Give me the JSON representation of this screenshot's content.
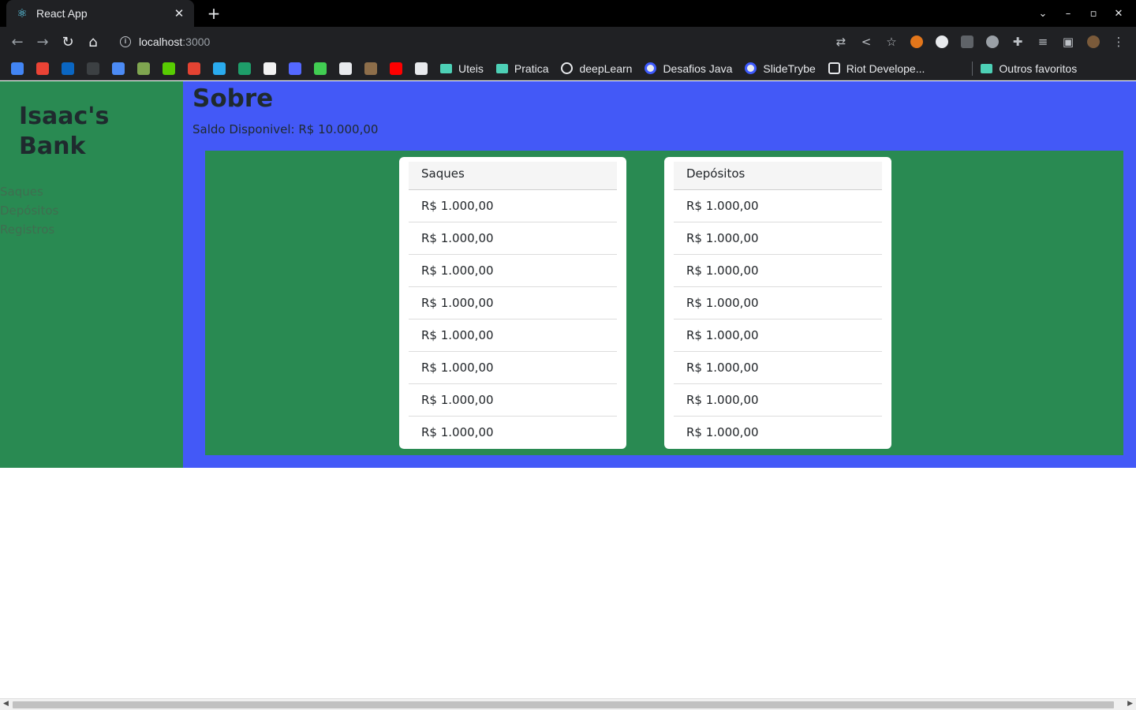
{
  "browser": {
    "tab_title": "React App",
    "tab_close": "✕",
    "new_tab": "+",
    "window_controls": [
      "⌄",
      "–",
      "▫",
      "✕"
    ],
    "url_host": "localhost",
    "url_port": ":3000",
    "bookmarks": {
      "icons": [
        {
          "name": "calendar-icon",
          "color": "#4285f4"
        },
        {
          "name": "gmail-icon",
          "color": "#ea4335"
        },
        {
          "name": "linkedin-icon",
          "color": "#0a66c2"
        },
        {
          "name": "github-icon",
          "color": "#3c4043"
        },
        {
          "name": "k-icon",
          "color": "#4c8bf5"
        },
        {
          "name": "chess-icon",
          "color": "#7fa650"
        },
        {
          "name": "owl-icon",
          "color": "#58cc02"
        },
        {
          "name": "todo-icon",
          "color": "#e44332"
        },
        {
          "name": "telegram-icon",
          "color": "#2aabee"
        },
        {
          "name": "vscode-icon",
          "color": "#1e9e6a"
        },
        {
          "name": "figma-icon",
          "color": "#f2f2f2"
        },
        {
          "name": "dev-icon",
          "color": "#5468ff"
        },
        {
          "name": "qt-icon",
          "color": "#41cd52"
        },
        {
          "name": "mask-icon",
          "color": "#e8eaed"
        },
        {
          "name": "poop-icon",
          "color": "#8d6e4a"
        },
        {
          "name": "youtube-icon",
          "color": "#ff0000"
        },
        {
          "name": "ninja-icon",
          "color": "#e8eaed"
        }
      ],
      "folders": [
        {
          "label": "Uteis",
          "glyph": "folder"
        },
        {
          "label": "Pratica",
          "glyph": "folder"
        },
        {
          "label": "deepLearn",
          "glyph": "globe"
        },
        {
          "label": "Desafios Java",
          "glyph": "circle"
        },
        {
          "label": "SlideTrybe",
          "glyph": "circle"
        },
        {
          "label": "Riot Develope...",
          "glyph": "fist"
        }
      ],
      "other_favorites": "Outros favoritos"
    }
  },
  "sidebar": {
    "brand": "Isaac's Bank",
    "nav": [
      "Saques",
      "Depósitos",
      "Registros"
    ]
  },
  "main": {
    "title": "Sobre",
    "saldo": "Saldo Disponivel: R$ 10.000,00",
    "cards": [
      {
        "header": "Saques",
        "rows": [
          "R$ 1.000,00",
          "R$ 1.000,00",
          "R$ 1.000,00",
          "R$ 1.000,00",
          "R$ 1.000,00",
          "R$ 1.000,00",
          "R$ 1.000,00",
          "R$ 1.000,00"
        ]
      },
      {
        "header": "Depósitos",
        "rows": [
          "R$ 1.000,00",
          "R$ 1.000,00",
          "R$ 1.000,00",
          "R$ 1.000,00",
          "R$ 1.000,00",
          "R$ 1.000,00",
          "R$ 1.000,00",
          "R$ 1.000,00"
        ]
      }
    ]
  },
  "colors": {
    "sidebar_bg": "#298a52",
    "content_bg": "#4359f7",
    "panel_bg": "#298a52"
  }
}
